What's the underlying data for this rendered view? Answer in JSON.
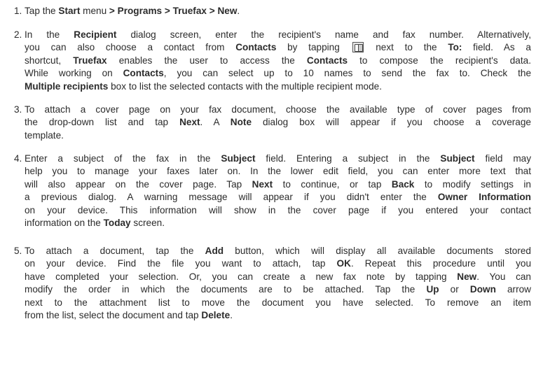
{
  "steps": [
    {
      "number": "1.",
      "parts": {
        "a": "Tap the ",
        "b": "Start",
        "c": " menu ",
        "d": "> Programs > Truefax > New",
        "e": "."
      }
    },
    {
      "number": "2.",
      "parts": {
        "a": "In the ",
        "b": "Recipient",
        "c": " dialog screen, enter the recipient's name and fax number. Alternatively,",
        "d": "you can also choose a contact from ",
        "e": "Contacts",
        "f": " by tapping ",
        "g": " next to the ",
        "h": "To:",
        "i": " field. As a",
        "j": "shortcut, ",
        "k": "Truefax",
        "l": " enables the user to access the ",
        "m": "Contacts",
        "n": " to compose the recipient's data.",
        "o": "While working on ",
        "p": "Contacts",
        "q": ", you can select up to 10 names to send the fax to. Check the",
        "r": "Multiple recipients",
        "s": " box to list the selected contacts with the multiple recipient mode."
      }
    },
    {
      "number": "3.",
      "parts": {
        "a": "To attach a cover page on your fax document, choose the available type of cover pages from",
        "b": "the drop-down list and tap ",
        "c": "Next",
        "d": ". A ",
        "e": "Note",
        "f": " dialog box will appear if you choose a coverage",
        "g": "template."
      }
    },
    {
      "number": "4.",
      "parts": {
        "a": "Enter a subject of the fax in the ",
        "b": "Subject",
        "c": " field. Entering a subject in the ",
        "d": "Subject",
        "e": " field may",
        "f": "help you to manage your faxes later on. In the lower edit field, you can enter more text that",
        "g": "will also appear on the cover page. Tap ",
        "h": "Next",
        "i": " to continue, or tap ",
        "j": "Back",
        "k": " to modify settings in",
        "l": "a previous dialog. A warning message will appear if you didn't enter the ",
        "m": "Owner Information",
        "n": "on your device. This information will show in the cover page if you entered your contact",
        "o": "information on the ",
        "p": "Today",
        "q": " screen."
      }
    },
    {
      "number": "5.",
      "parts": {
        "a": "To attach a document, tap the ",
        "b": "Add",
        "c": " button, which will display all available documents stored",
        "d": "on your device. Find the file you want to attach, tap ",
        "e": "OK",
        "f": ". Repeat this procedure until you",
        "g": "have completed your selection. Or, you can create a new fax note by tapping ",
        "h": "New",
        "i": ". You can",
        "j": "modify the order in which the documents are to be attached. Tap the ",
        "k": "Up",
        "l": " or ",
        "m": "Down",
        "n": " arrow",
        "o": "next to the attachment list to move the document you have selected. To remove an item",
        "p": "from the list, select the document and tap ",
        "q": "Delete",
        "r": "."
      }
    }
  ]
}
